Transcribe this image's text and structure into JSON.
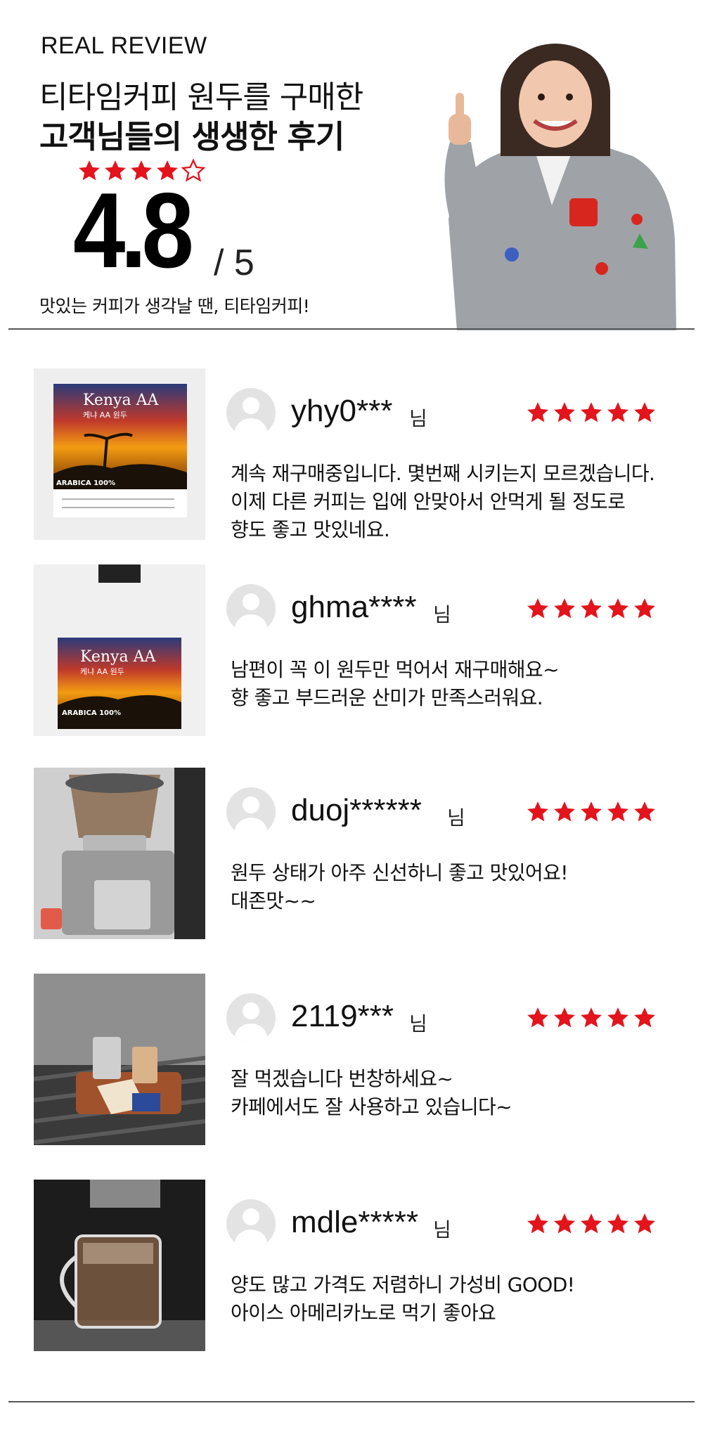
{
  "header": {
    "eyebrow": "REAL REVIEW",
    "title_line1": "티타임커피 원두를 구매한",
    "title_line2": "고객님들의 생생한 후기",
    "score": "4.8",
    "score_max": "/ 5",
    "rating_value": 4.8,
    "rating_max": 5,
    "tagline": "맛있는 커피가 생각날 땐, 티타임커피!"
  },
  "honorific": "님",
  "colors": {
    "star": "#e3141c",
    "divider": "#555555",
    "avatar_bg": "#e3e3e3"
  },
  "reviews": [
    {
      "username": "yhy0***",
      "rating": 5,
      "text_lines": [
        "계속 재구매중입니다. 몇번째 시키는지 모르겠습니다.",
        "이제 다른 커피는 입에 안맞아서 안먹게 될 정도로",
        "향도 좋고 맛있네요."
      ],
      "photo": {
        "label": "Kenya AA",
        "sublabel": "케냐 AA 원두",
        "tag": "ARABICA 100%"
      }
    },
    {
      "username": "ghma****",
      "rating": 5,
      "text_lines": [
        "남편이 꼭 이 원두만 먹어서 재구매해요~",
        "향 좋고 부드러운 산미가 만족스러워요."
      ],
      "photo": {
        "label": "Kenya AA",
        "sublabel": "케냐 AA 원두",
        "tag": "ARABICA 100%"
      }
    },
    {
      "username": "duoj******",
      "rating": 5,
      "text_lines": [
        "원두 상태가 아주 신선하니 좋고 맛있어요!",
        "대존맛~~"
      ],
      "photo": {
        "scene": "coffee-grinder"
      }
    },
    {
      "username": "2119***",
      "rating": 5,
      "text_lines": [
        "잘 먹겠습니다 번창하세요~",
        "카페에서도 잘 사용하고 있습니다~"
      ],
      "photo": {
        "scene": "cups-on-tray"
      }
    },
    {
      "username": "mdle*****",
      "rating": 5,
      "text_lines": [
        "양도 많고 가격도 저렴하니 가성비 GOOD!",
        "아이스 아메리카노로 먹기 좋아요"
      ],
      "photo": {
        "scene": "espresso-machine-glass"
      }
    }
  ]
}
